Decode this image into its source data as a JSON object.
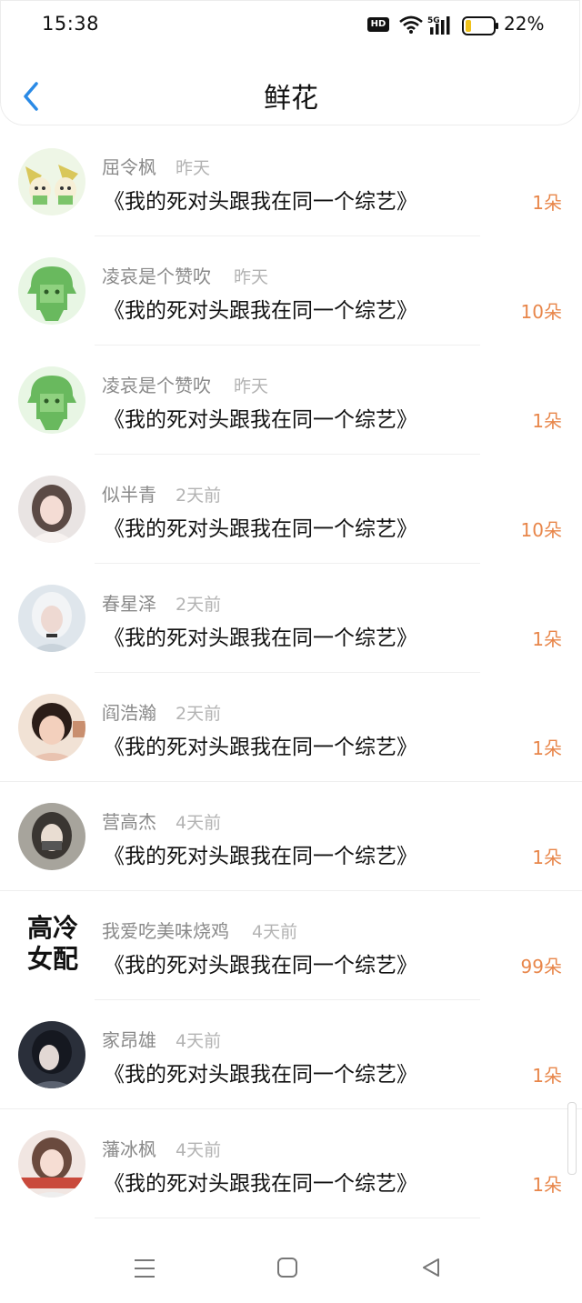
{
  "status": {
    "time": "15:38",
    "hd_label": "HD",
    "battery_text": "22%",
    "battery_level": 0.22
  },
  "header": {
    "back_icon": "chevron-left-icon",
    "title": "鲜花"
  },
  "rows": [
    {
      "name": "屈令枫",
      "time": "昨天",
      "book": "《我的死对头跟我在同一个综艺》",
      "count": "1朵",
      "avatar": "elf-cartoon"
    },
    {
      "name": "凌哀是个赞吹",
      "time": "昨天",
      "book": "《我的死对头跟我在同一个综艺》",
      "count": "10朵",
      "avatar": "green-cartoon"
    },
    {
      "name": "凌哀是个赞吹",
      "time": "昨天",
      "book": "《我的死对头跟我在同一个综艺》",
      "count": "1朵",
      "avatar": "green-cartoon"
    },
    {
      "name": "似半青",
      "time": "2天前",
      "book": "《我的死对头跟我在同一个综艺》",
      "count": "10朵",
      "avatar": "girl-photo"
    },
    {
      "name": "春星泽",
      "time": "2天前",
      "book": "《我的死对头跟我在同一个综艺》",
      "count": "1朵",
      "avatar": "silver-hair-photo"
    },
    {
      "name": "阎浩瀚",
      "time": "2天前",
      "book": "《我的死对头跟我在同一个综艺》",
      "count": "1朵",
      "avatar": "child-photo"
    },
    {
      "name": "营高杰",
      "time": "4天前",
      "book": "《我的死对头跟我在同一个综艺》",
      "count": "1朵",
      "avatar": "drawn-girl"
    },
    {
      "name": "我爱吃美味烧鸡",
      "time": "4天前",
      "book": "《我的死对头跟我在同一个综艺》",
      "count": "99朵",
      "avatar_text": "高冷\n女配"
    },
    {
      "name": "家昂雄",
      "time": "4天前",
      "book": "《我的死对头跟我在同一个综艺》",
      "count": "1朵",
      "avatar": "dark-photo"
    },
    {
      "name": "藩冰枫",
      "time": "4天前",
      "book": "《我的死对头跟我在同一个综艺》",
      "count": "1朵",
      "avatar": "smile-photo"
    }
  ],
  "nav": {
    "menu_icon": "menu-icon",
    "home_icon": "home-square-icon",
    "back_icon": "back-triangle-icon"
  },
  "colors": {
    "accent_blue": "#2a8ae6",
    "count_orange": "#e8864a",
    "name_gray": "#8a8a8a",
    "time_gray": "#b3b3b3"
  }
}
